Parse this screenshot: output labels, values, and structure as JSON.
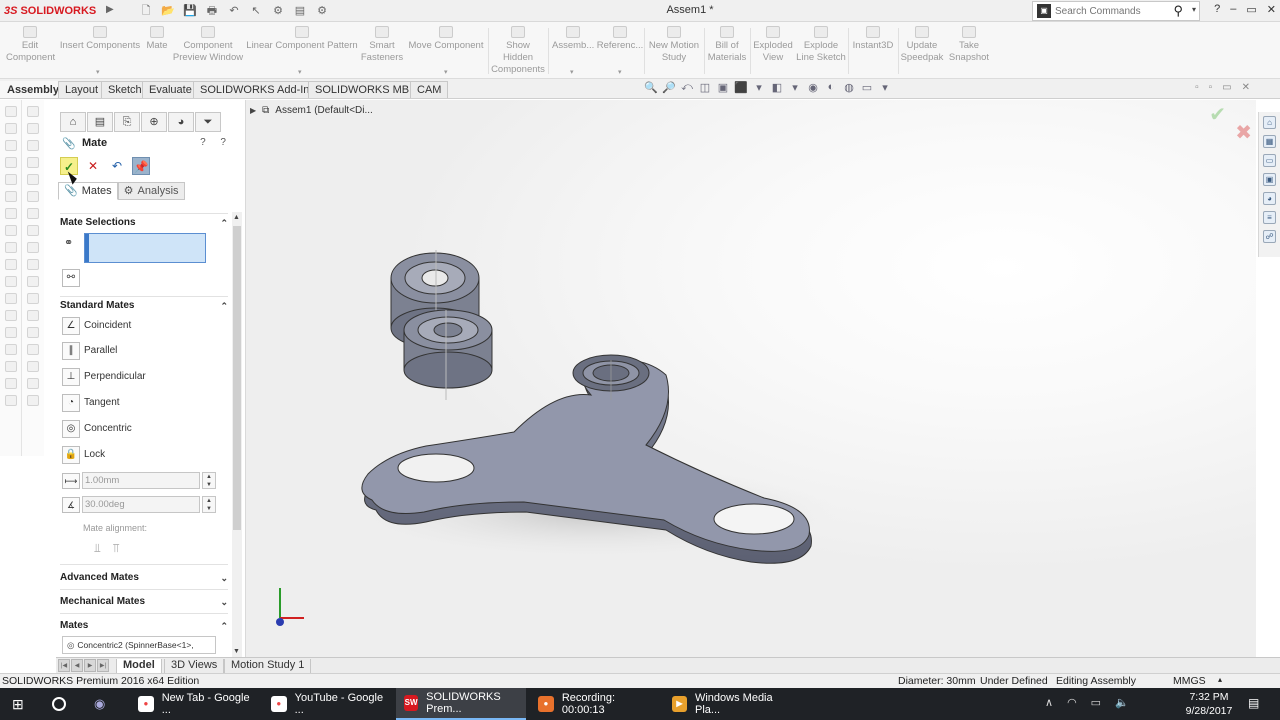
{
  "app": {
    "logo_text": "SOLIDWORKS",
    "document_title": "Assem1 *",
    "search_placeholder": "Search Commands",
    "help_label": "?"
  },
  "command_manager": [
    {
      "label": "Edit\nComponent"
    },
    {
      "label": "Insert Components"
    },
    {
      "label": "Mate"
    },
    {
      "label": "Component\nPreview Window"
    },
    {
      "label": "Linear Component Pattern"
    },
    {
      "label": "Smart\nFasteners"
    },
    {
      "label": "Move Component"
    },
    {
      "label": "Show Hidden\nComponents"
    },
    {
      "label": "Assemb..."
    },
    {
      "label": "Referenc..."
    },
    {
      "label": "New Motion\nStudy"
    },
    {
      "label": "Bill of\nMaterials"
    },
    {
      "label": "Exploded\nView"
    },
    {
      "label": "Explode\nLine Sketch"
    },
    {
      "label": "Instant3D"
    },
    {
      "label": "Update\nSpeedpak"
    },
    {
      "label": "Take\nSnapshot"
    }
  ],
  "tabs": [
    {
      "label": "Assembly",
      "active": true
    },
    {
      "label": "Layout"
    },
    {
      "label": "Sketch"
    },
    {
      "label": "Evaluate"
    },
    {
      "label": "SOLIDWORKS Add-Ins"
    },
    {
      "label": "SOLIDWORKS MBD"
    },
    {
      "label": "CAM"
    }
  ],
  "property_manager": {
    "title": "Mate",
    "help_icons": "? ?",
    "subtabs": [
      {
        "label": "Mates",
        "active": true
      },
      {
        "label": "Analysis"
      }
    ],
    "sections": {
      "mate_selections": "Mate Selections",
      "standard_mates": "Standard Mates",
      "advanced_mates": "Advanced Mates",
      "mechanical_mates": "Mechanical Mates",
      "mates": "Mates"
    },
    "standard_mates": [
      {
        "label": "Coincident",
        "icon": "coincident-icon"
      },
      {
        "label": "Parallel",
        "icon": "parallel-icon"
      },
      {
        "label": "Perpendicular",
        "icon": "perpendicular-icon"
      },
      {
        "label": "Tangent",
        "icon": "tangent-icon"
      },
      {
        "label": "Concentric",
        "icon": "concentric-icon"
      },
      {
        "label": "Lock",
        "icon": "lock-icon"
      }
    ],
    "distance_value": "1.00mm",
    "angle_value": "30.00deg",
    "mate_alignment_label": "Mate alignment:",
    "mates_list": [
      "Concentric2 (SpinnerBase<1>,"
    ]
  },
  "graphics": {
    "tree_flyout": "Assem1  (Default<Di..."
  },
  "bottom_tabs": [
    {
      "label": "Model",
      "active": true
    },
    {
      "label": "3D Views"
    },
    {
      "label": "Motion Study 1"
    }
  ],
  "status_bar": {
    "edition": "SOLIDWORKS Premium 2016 x64 Edition",
    "diameter": "Diameter: 30mm",
    "state": "Under Defined",
    "mode": "Editing Assembly",
    "units": "MMGS"
  },
  "taskbar": {
    "items": [
      {
        "label": "New Tab - Google ...",
        "icon": "chrome-icon"
      },
      {
        "label": "YouTube - Google ...",
        "icon": "chrome-icon"
      },
      {
        "label": "SOLIDWORKS Prem...",
        "icon": "solidworks-icon",
        "active": true
      },
      {
        "label": "Recording:  00:00:13",
        "icon": "recording-icon"
      },
      {
        "label": "Windows Media Pla...",
        "icon": "media-player-icon"
      }
    ],
    "time": "7:32 PM",
    "date": "9/28/2017"
  },
  "colors": {
    "part_face": "#8d93a8",
    "part_top": "#9ea4ba",
    "solidworks_red": "#d71920",
    "ok_yellow": "#f6f08c"
  }
}
